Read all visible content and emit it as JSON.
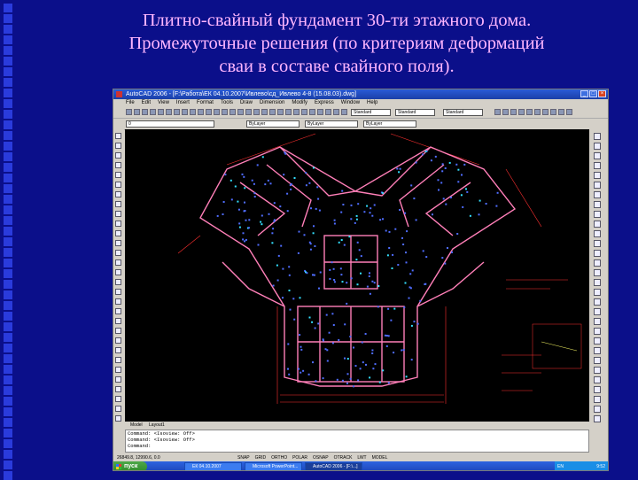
{
  "slide": {
    "title_lines": [
      "Плитно-свайный фундамент 30-ти этажного дома.",
      "Промежуточные решения (по критериям деформаций",
      "сваи в составе свайного поля)."
    ]
  },
  "app": {
    "window_title": "AutoCAD 2006 - [F:\\Работа\\ЕК 04.10.2007\\Ивлево\\сд_Ивлево 4-8 (15.08.03).dwg]",
    "menu": [
      "File",
      "Edit",
      "View",
      "Insert",
      "Format",
      "Tools",
      "Draw",
      "Dimension",
      "Modify",
      "Express",
      "Window",
      "Help"
    ],
    "layer_combo": "0",
    "style_combo_1": "ByLayer",
    "style_combo_2": "ByLayer",
    "style_combo_3": "ByLayer",
    "text_style": "Standard",
    "dim_style": "Standard",
    "layout_tabs": [
      "Model",
      "Layout1"
    ],
    "command_lines": [
      "Command: <Isoview: Off>",
      "Command: <Isoview: Off>",
      "Command:"
    ],
    "status_coords": "26849.8, 12990.6, 0.0",
    "status_modes": [
      "SNAP",
      "GRID",
      "ORTHO",
      "POLAR",
      "OSNAP",
      "OTRACK",
      "LWT",
      "MODEL"
    ]
  },
  "taskbar": {
    "start_label": "пуск",
    "tasks": [
      "ЕК 04.10.2007",
      "Microsoft PowerPoint...",
      "AutoCAD 2006 - [F:\\...]"
    ],
    "lang": "EN",
    "clock": "9:52"
  },
  "colors": {
    "slide_bg": "#0b0f8a",
    "title_text": "#ffb6ff",
    "walls": "#ff7fb8",
    "piles": "#4f6dff",
    "dims": "#ff3030"
  }
}
